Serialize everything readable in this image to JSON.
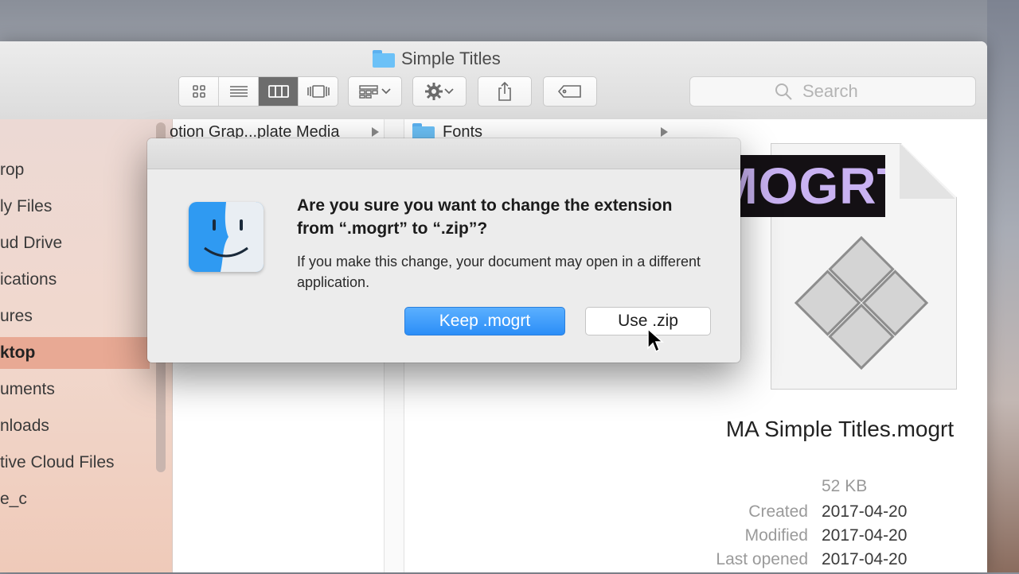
{
  "window": {
    "title": "Simple Titles"
  },
  "toolbar": {
    "views": [
      {
        "name": "icon-view",
        "icon": "grid-icon"
      },
      {
        "name": "list-view",
        "icon": "list-icon"
      },
      {
        "name": "column-view",
        "icon": "columns-icon",
        "active": true
      },
      {
        "name": "gallery-view",
        "icon": "coverflow-icon"
      }
    ],
    "search_placeholder": "Search"
  },
  "sidebar": {
    "items": [
      {
        "label": "rop"
      },
      {
        "label": "ly Files"
      },
      {
        "label": "ud Drive"
      },
      {
        "label": "ications"
      },
      {
        "label": "ures"
      },
      {
        "label": "ktop",
        "selected": true
      },
      {
        "label": "uments"
      },
      {
        "label": "nloads"
      },
      {
        "label": "tive Cloud Files"
      },
      {
        "label": "e_c"
      }
    ]
  },
  "columns": {
    "col1_item": "otion Grap...plate Media",
    "col2_item": "Fonts"
  },
  "preview": {
    "badge": "MOGRT",
    "filename": "MA Simple Titles.mogrt",
    "size": "52 KB",
    "created_label": "Created",
    "created": "2017-04-20",
    "modified_label": "Modified",
    "modified": "2017-04-20",
    "last_opened_label": "Last opened",
    "last_opened": "2017-04-20"
  },
  "dialog": {
    "title": "Are you sure you want to change the extension from “.mogrt” to “.zip”?",
    "message": "If you make this change, your document may open in a different application.",
    "keep_button": "Keep .mogrt",
    "use_button": "Use .zip"
  },
  "colors": {
    "accent": "#2b8ef7",
    "sidebar_selected": "#e8a994"
  }
}
